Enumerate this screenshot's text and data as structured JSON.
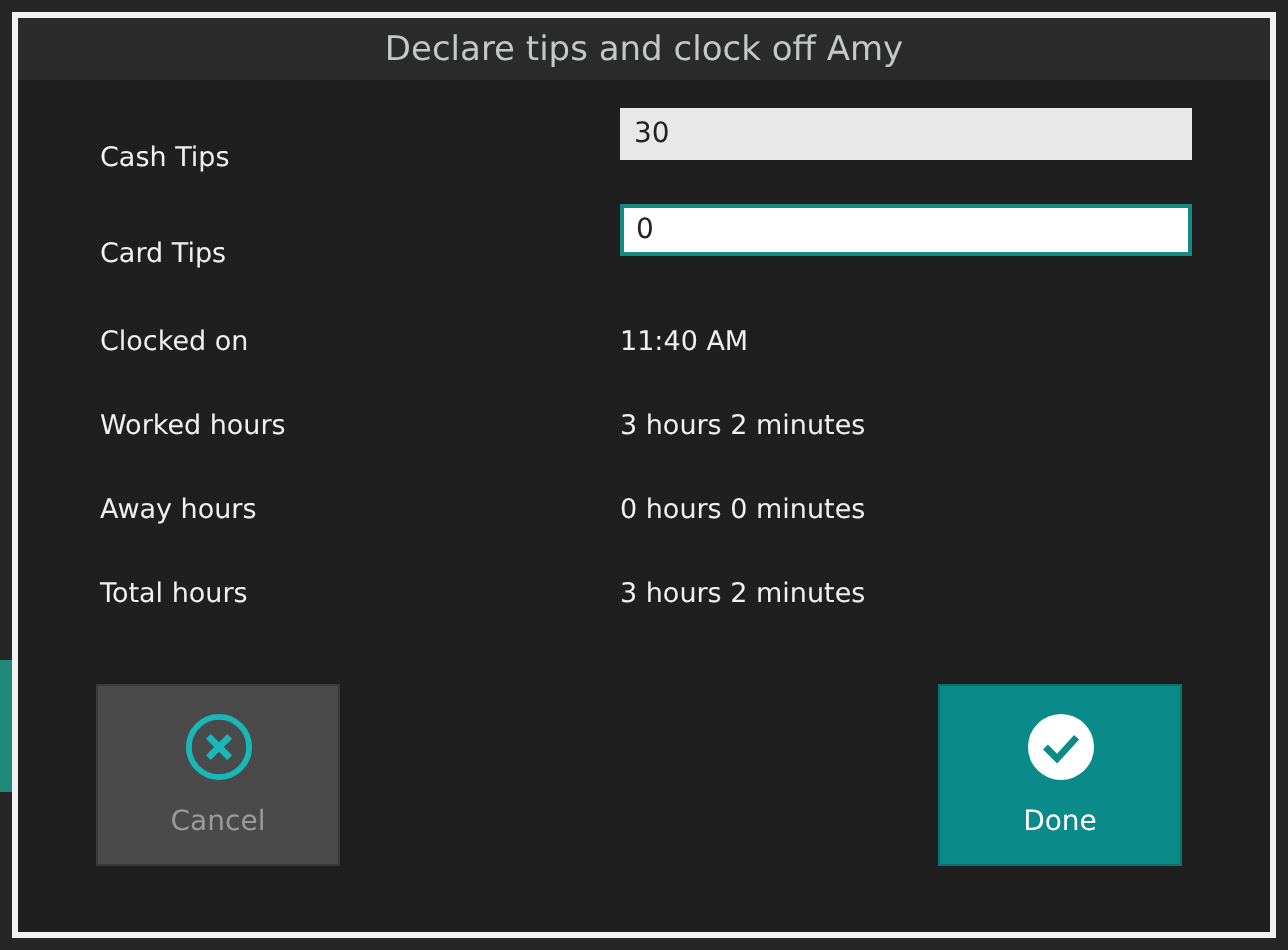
{
  "dialog": {
    "title": "Declare tips and clock off Amy"
  },
  "fields": [
    {
      "label": "Cash Tips",
      "value": "30",
      "focused": false
    },
    {
      "label": "Card Tips",
      "value": "0",
      "focused": true
    }
  ],
  "details": [
    {
      "label": "Clocked on",
      "value": "11:40 AM"
    },
    {
      "label": "Worked hours",
      "value": "3 hours 2 minutes"
    },
    {
      "label": "Away hours",
      "value": "0 hours 0 minutes"
    },
    {
      "label": "Total hours",
      "value": "3 hours 2 minutes"
    }
  ],
  "buttons": [
    {
      "kind": "cancel",
      "label": "Cancel",
      "disabled": true
    },
    {
      "kind": "done",
      "label": "Done",
      "disabled": false
    }
  ]
}
